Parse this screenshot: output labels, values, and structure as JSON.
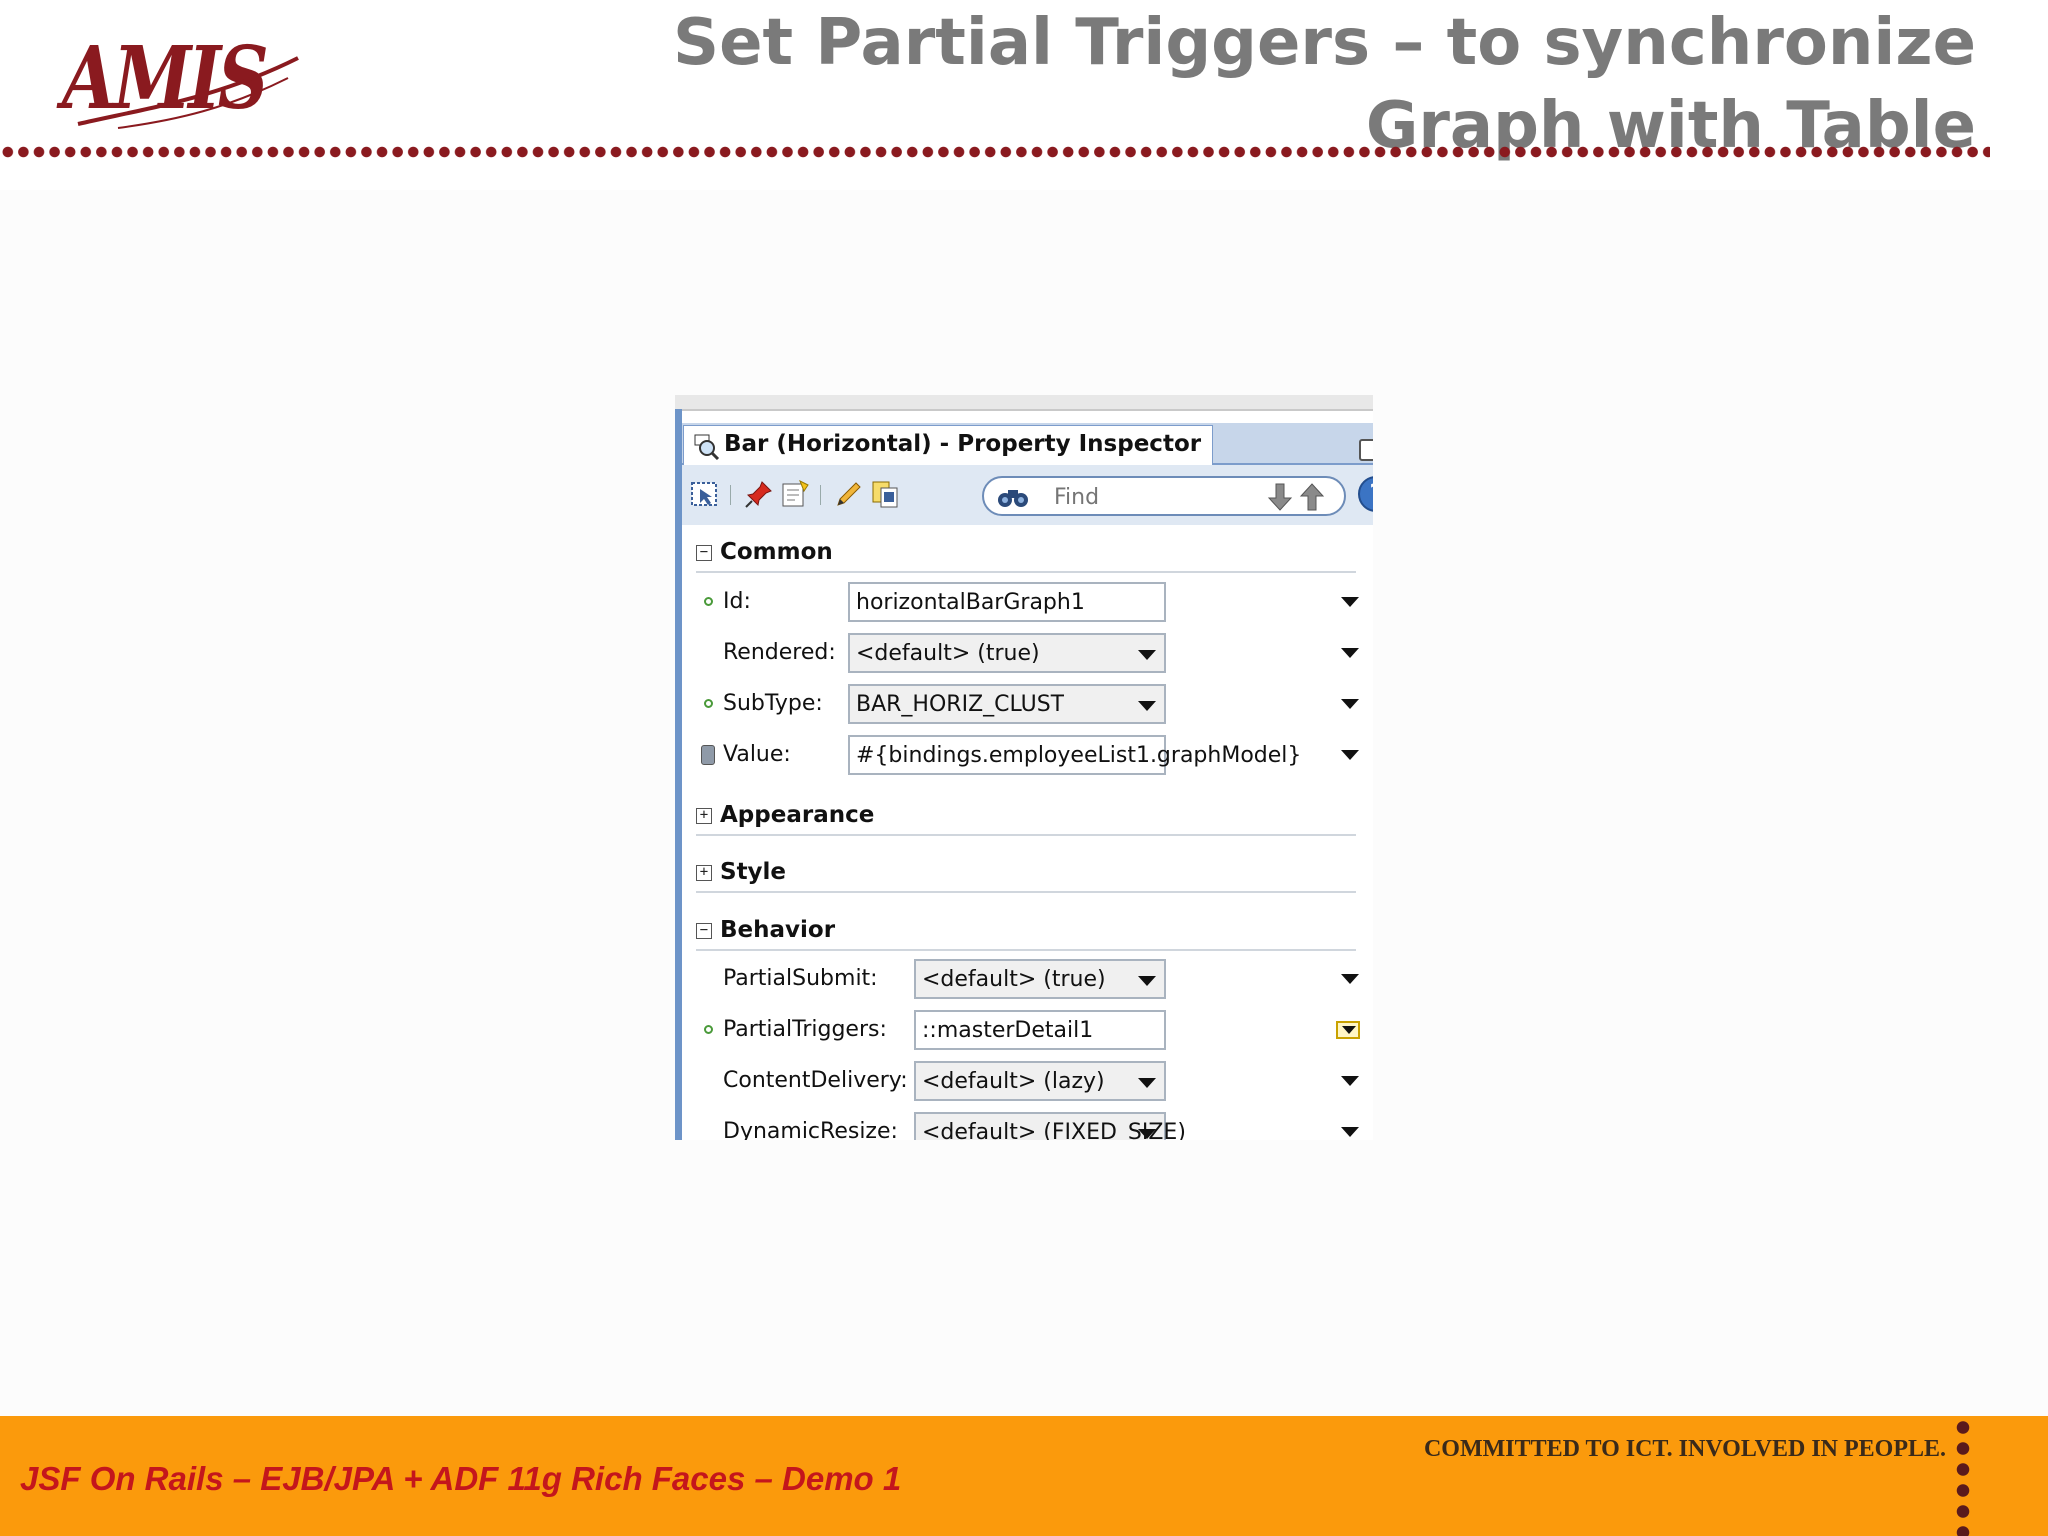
{
  "slide": {
    "logo": "AMIS",
    "title": "Set Partial Triggers – to synchronize Graph with Table"
  },
  "inspector": {
    "tab_title": "Bar (Horizontal) - Property Inspector",
    "find_placeholder": "Find",
    "help_label": "?",
    "sections": {
      "common": "Common",
      "appearance": "Appearance",
      "style": "Style",
      "behavior": "Behavior"
    },
    "common_rows": [
      {
        "label": "Id:",
        "value": "horizontalBarGraph1"
      },
      {
        "label": "Rendered:",
        "value": "<default> (true)"
      },
      {
        "label": "SubType:",
        "value": "BAR_HORIZ_CLUST"
      },
      {
        "label": "Value:",
        "value": "#{bindings.employeeList1.graphModel}"
      }
    ],
    "behavior_rows": [
      {
        "label": "PartialSubmit:",
        "value": "<default> (true)"
      },
      {
        "label": "PartialTriggers:",
        "value": "::masterDetail1"
      },
      {
        "label": "ContentDelivery:",
        "value": "<default> (lazy)"
      },
      {
        "label": "DynamicResize:",
        "value": "<default> (FIXED_SIZE)"
      }
    ],
    "collapsed_sign": "+",
    "expanded_sign": "−"
  },
  "footer": {
    "left_text": "JSF On Rails – EJB/JPA + ADF 11g Rich Faces – Demo 1",
    "right_text": "COMMITTED TO ICT. INVOLVED IN PEOPLE."
  },
  "colors": {
    "brand": "#8a1a1f",
    "footer_bg": "#fb9a0c",
    "footer_text": "#c4161c",
    "title": "#7a7a7a"
  }
}
